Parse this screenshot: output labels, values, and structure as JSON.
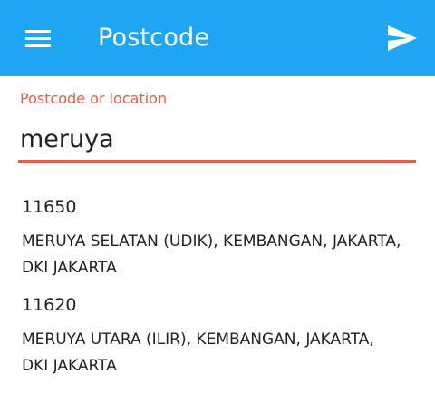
{
  "app_bar": {
    "title": "Postcode",
    "menu_icon": "hamburger-menu-icon",
    "send_icon": "send-icon",
    "background": "#1ea6f4"
  },
  "search": {
    "label": "Postcode or location",
    "value": "meruya",
    "accent": "#e0604a"
  },
  "results": [
    {
      "code": "11650",
      "description": "MERUYA SELATAN (UDIK), KEMBANGAN, JAKARTA, DKI JAKARTA"
    },
    {
      "code": "11620",
      "description": "MERUYA UTARA (ILIR), KEMBANGAN, JAKARTA, DKI JAKARTA"
    }
  ]
}
